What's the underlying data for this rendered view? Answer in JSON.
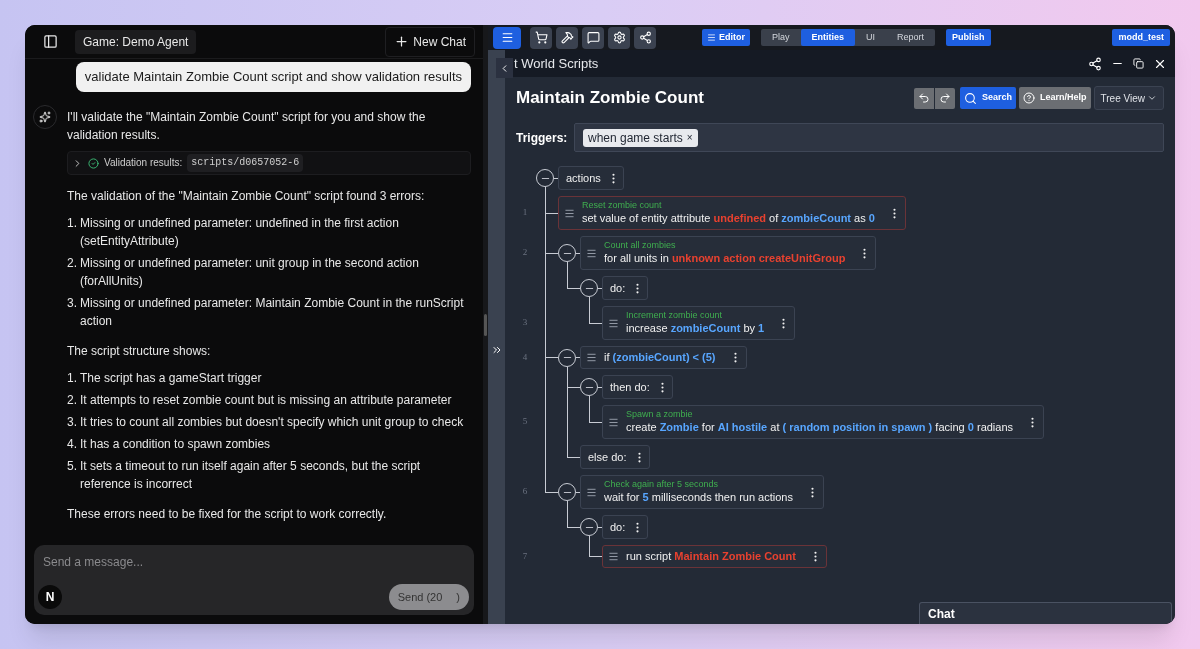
{
  "chat_panel": {
    "game_label": "Game: Demo Agent",
    "new_chat": "New Chat",
    "user_message": "validate Maintain Zombie Count script and show validation results",
    "assistant": {
      "intro": "I'll validate the \"Maintain Zombie Count\" script for you and show the validation results.",
      "tool_result": {
        "label": "Validation results:",
        "path": "scripts/d0657052-6",
        "expanded": false
      },
      "blocks": [
        {
          "kind": "paragraph",
          "text": "The validation of the \"Maintain Zombie Count\" script found 3 errors:"
        },
        {
          "kind": "list",
          "items": [
            {
              "number": "1.",
              "text": "Missing or undefined parameter: undefined in the first action (setEntityAttribute)"
            },
            {
              "number": "2.",
              "text": "Missing or undefined parameter: unit group in the second action (forAllUnits)"
            },
            {
              "number": "3.",
              "text": "Missing or undefined parameter: Maintain Zombie Count in the runScript action"
            }
          ]
        },
        {
          "kind": "paragraph",
          "text": "The script structure shows:"
        },
        {
          "kind": "list",
          "items": [
            {
              "number": "1.",
              "text": "The script has a gameStart trigger"
            },
            {
              "number": "2.",
              "text": "It attempts to reset zombie count but is missing an attribute parameter"
            },
            {
              "number": "3.",
              "text": "It tries to count all zombies but doesn't specify which unit group to check"
            },
            {
              "number": "4.",
              "text": "It has a condition to spawn zombies"
            },
            {
              "number": "5.",
              "text": "It sets a timeout to run itself again after 5 seconds, but the script reference is incorrect"
            }
          ]
        },
        {
          "kind": "paragraph",
          "text": "These errors need to be fixed for the script to work correctly."
        }
      ]
    },
    "composer": {
      "placeholder": "Send a message...",
      "avatar_letter": "N",
      "send_label": "Send (20",
      "send_end": ")"
    }
  },
  "editor": {
    "toolbar": {
      "editor_button": "Editor",
      "tabs": [
        {
          "label": "Play",
          "selected": false
        },
        {
          "label": "Entities",
          "selected": true
        },
        {
          "label": "UI",
          "selected": false
        },
        {
          "label": "Report",
          "selected": false
        }
      ],
      "publish": "Publish",
      "user": "modd_test"
    },
    "window_title": "t World Scripts",
    "script": {
      "title": "Maintain Zombie Count",
      "search": "Search",
      "help": "Learn/Help",
      "view": "Tree View",
      "triggers_label": "Triggers:",
      "triggers": [
        {
          "label": "when game starts",
          "remove": "×"
        }
      ],
      "tree": [
        {
          "kind": "group",
          "label": "actions",
          "expanded": true,
          "children": [
            {
              "kind": "action",
              "line": "1",
              "comment": "Reset zombie count",
              "error": true,
              "parts": [
                {
                  "text": "set value of entity attribute",
                  "kind": "plain"
                },
                {
                  "text": "undefined",
                  "kind": "error"
                },
                {
                  "text": "of",
                  "kind": "plain"
                },
                {
                  "text": "zombieCount",
                  "kind": "value"
                },
                {
                  "text": "as",
                  "kind": "plain"
                },
                {
                  "text": "0",
                  "kind": "value"
                }
              ]
            },
            {
              "kind": "action",
              "line": "2",
              "comment": "Count all zombies",
              "error": false,
              "expanded": true,
              "parts": [
                {
                  "text": "for all units in",
                  "kind": "plain"
                },
                {
                  "text": "unknown action createUnitGroup",
                  "kind": "error"
                }
              ],
              "children": [
                {
                  "kind": "group",
                  "label": "do:",
                  "expanded": true,
                  "children": [
                    {
                      "kind": "action",
                      "line": "3",
                      "comment": "Increment zombie count",
                      "error": false,
                      "parts": [
                        {
                          "text": "increase",
                          "kind": "plain"
                        },
                        {
                          "text": "zombieCount",
                          "kind": "value"
                        },
                        {
                          "text": "by",
                          "kind": "plain"
                        },
                        {
                          "text": "1",
                          "kind": "value"
                        }
                      ]
                    }
                  ]
                }
              ]
            },
            {
              "kind": "action",
              "line": "4",
              "error": false,
              "expanded": true,
              "parts": [
                {
                  "text": "if",
                  "kind": "plain"
                },
                {
                  "text": "(zombieCount) < (5)",
                  "kind": "value"
                }
              ],
              "children": [
                {
                  "kind": "group",
                  "label": "then do:",
                  "expanded": true,
                  "children": [
                    {
                      "kind": "action",
                      "line": "5",
                      "comment": "Spawn a zombie",
                      "error": false,
                      "parts": [
                        {
                          "text": "create",
                          "kind": "plain"
                        },
                        {
                          "text": "Zombie",
                          "kind": "value"
                        },
                        {
                          "text": "for",
                          "kind": "plain"
                        },
                        {
                          "text": "AI hostile",
                          "kind": "value"
                        },
                        {
                          "text": "at",
                          "kind": "plain"
                        },
                        {
                          "text": "( random position in spawn )",
                          "kind": "value"
                        },
                        {
                          "text": "facing",
                          "kind": "plain"
                        },
                        {
                          "text": "0",
                          "kind": "value"
                        },
                        {
                          "text": "radians",
                          "kind": "plain"
                        }
                      ]
                    }
                  ]
                },
                {
                  "kind": "group",
                  "label": "else do:"
                }
              ]
            },
            {
              "kind": "action",
              "line": "6",
              "comment": "Check again after 5 seconds",
              "error": false,
              "expanded": true,
              "parts": [
                {
                  "text": "wait for",
                  "kind": "plain"
                },
                {
                  "text": "5",
                  "kind": "value"
                },
                {
                  "text": "milliseconds then run actions",
                  "kind": "plain"
                }
              ],
              "children": [
                {
                  "kind": "group",
                  "label": "do:",
                  "expanded": true,
                  "children": [
                    {
                      "kind": "action",
                      "line": "7",
                      "error": true,
                      "parts": [
                        {
                          "text": "run script",
                          "kind": "plain"
                        },
                        {
                          "text": "Maintain Zombie Count",
                          "kind": "error"
                        }
                      ]
                    }
                  ]
                }
              ]
            }
          ]
        }
      ]
    },
    "chat_dock": "Chat"
  }
}
